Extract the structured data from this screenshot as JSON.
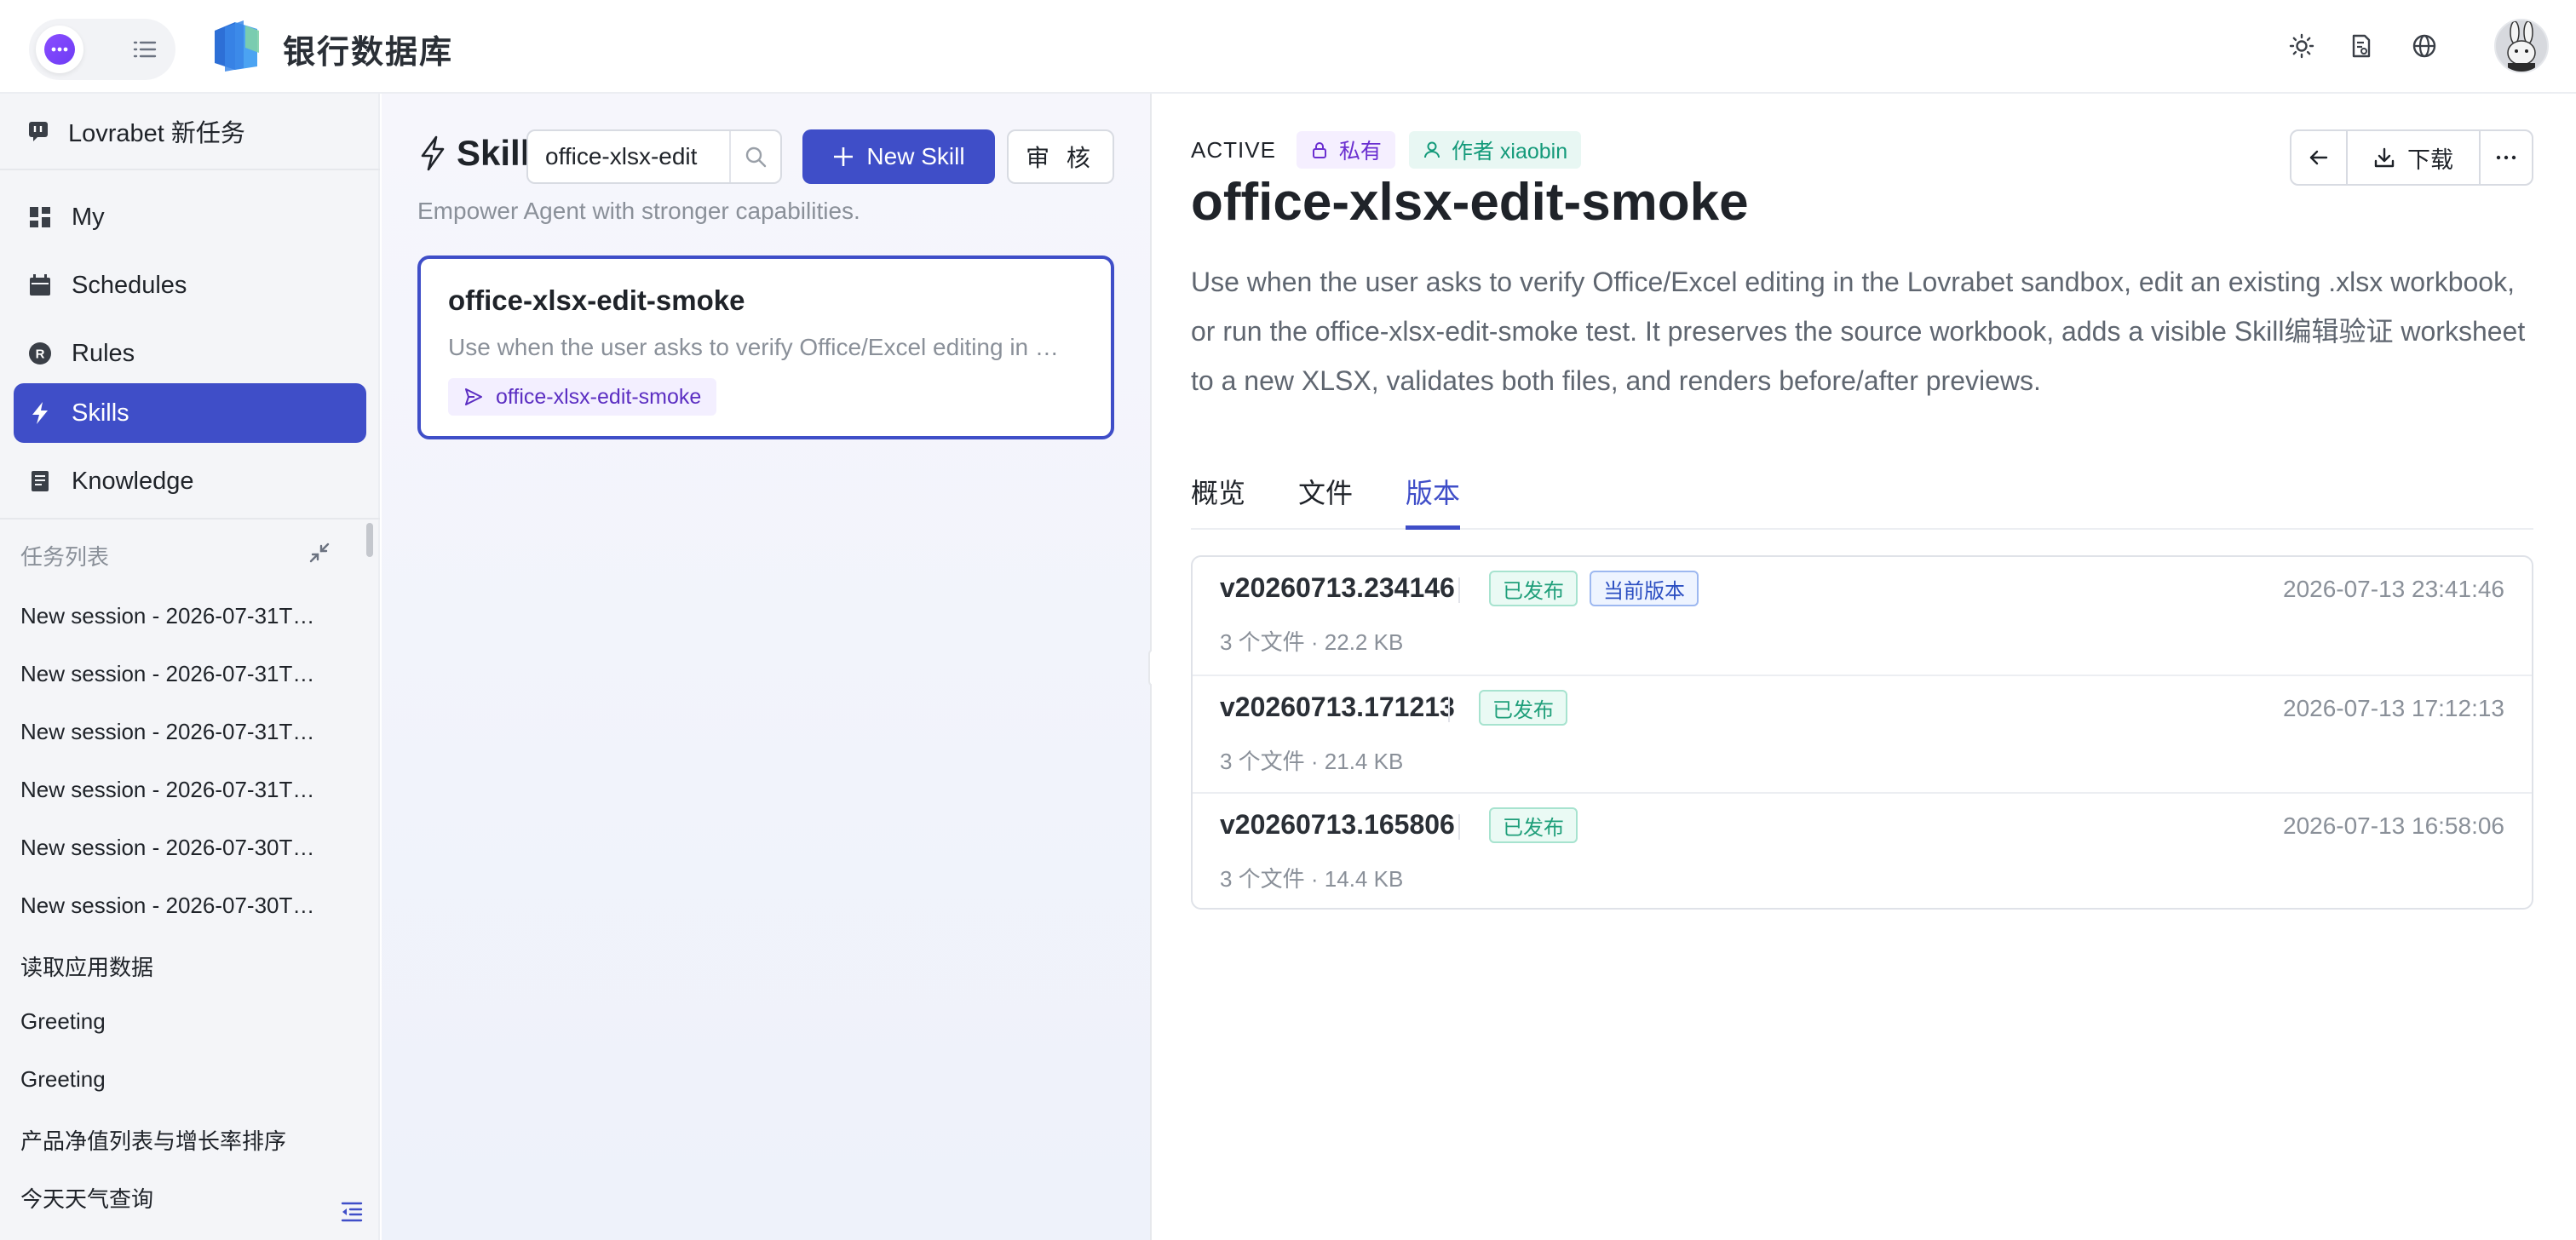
{
  "header": {
    "app_title": "银行数据库",
    "icons": [
      "chat-mode-icon",
      "list-mode-icon",
      "sun-icon",
      "document-icon",
      "globe-icon"
    ]
  },
  "sidebar": {
    "new_task": "Lovrabet 新任务",
    "items": [
      {
        "label": "My",
        "icon": "grid-icon"
      },
      {
        "label": "Schedules",
        "icon": "calendar-icon"
      },
      {
        "label": "Rules",
        "icon": "rules-icon"
      },
      {
        "label": "Skills",
        "icon": "lightning-icon",
        "active": true
      },
      {
        "label": "Knowledge",
        "icon": "book-icon"
      }
    ],
    "task_list_header": "任务列表",
    "tasks": [
      "New session - 2026-07-31T…",
      "New session - 2026-07-31T…",
      "New session - 2026-07-31T…",
      "New session - 2026-07-31T…",
      "New session - 2026-07-30T…",
      "New session - 2026-07-30T…",
      "读取应用数据",
      "Greeting",
      "Greeting",
      "产品净值列表与增长率排序",
      "今天天气查询"
    ]
  },
  "skills_panel": {
    "title": "Skill",
    "search_value": "office-xlsx-edit",
    "new_skill_label": "New Skill",
    "review_label": "审 核",
    "subtitle": "Empower Agent with stronger capabilities.",
    "card": {
      "name": "office-xlsx-edit-smoke",
      "desc": "Use when the user asks to verify Office/Excel editing in …",
      "tag": "office-xlsx-edit-smoke"
    }
  },
  "detail": {
    "status": "ACTIVE",
    "privacy": "私有",
    "author": "作者 xiaobin",
    "title": "office-xlsx-edit-smoke",
    "download_label": "下载",
    "description": "Use when the user asks to verify Office/Excel editing in the Lovrabet sandbox, edit an existing .xlsx workbook, or run the office-xlsx-edit-smoke test. It preserves the source workbook, adds a visible Skill编辑验证 worksheet to a new XLSX, validates both files, and renders before/after previews.",
    "tabs": [
      "概览",
      "文件",
      "版本"
    ],
    "active_tab": "版本",
    "versions": [
      {
        "name": "v20260713.234146",
        "published": "已发布",
        "current": "当前版本",
        "meta": "3 个文件 · 22.2 KB",
        "time": "2026-07-13 23:41:46"
      },
      {
        "name": "v20260713.171213",
        "published": "已发布",
        "current": "",
        "meta": "3 个文件 · 21.4 KB",
        "time": "2026-07-13 17:12:13"
      },
      {
        "name": "v20260713.165806",
        "published": "已发布",
        "current": "",
        "meta": "3 个文件 · 14.4 KB",
        "time": "2026-07-13 16:58:06"
      }
    ]
  },
  "colors": {
    "accent": "#3f4ec8",
    "published_green": "#1f9f7a",
    "current_blue": "#2c4fc2",
    "private_purple": "#6b2fd0"
  }
}
